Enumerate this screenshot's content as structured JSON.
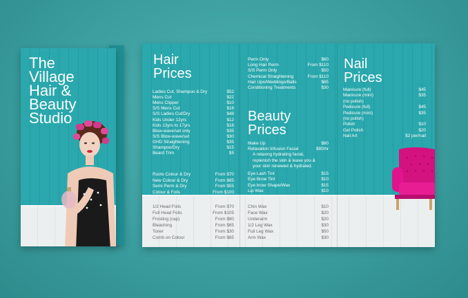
{
  "front": {
    "title_lines": [
      "The",
      "Village",
      "Hair &",
      "Beauty",
      "Studio"
    ]
  },
  "hair": {
    "title_line1": "Hair",
    "title_line2": "Prices",
    "items": [
      {
        "name": "Ladies Cut, Shampoo & Dry",
        "price": "$52"
      },
      {
        "name": "Mens Cut",
        "price": "$22"
      },
      {
        "name": "Mens Clipper",
        "price": "$10"
      },
      {
        "name": "S/S Mens Cut",
        "price": "$18"
      },
      {
        "name": "S/S Ladies Cut/Dry",
        "price": "$48"
      },
      {
        "name": "Kids Under 12yrs",
        "price": "$12"
      },
      {
        "name": "Kids 13yrs to 17yrs",
        "price": "$18"
      },
      {
        "name": "Blow-wave/set only",
        "price": "$35"
      },
      {
        "name": "S/S Blow-wave/set",
        "price": "$30"
      },
      {
        "name": "GHD Straightening",
        "price": "$35"
      },
      {
        "name": "Shampoo/Dry",
        "price": "$15"
      },
      {
        "name": "Beard Trim",
        "price": "$5"
      }
    ],
    "colour_items": [
      {
        "name": "Roots Colour & Dry",
        "price": "From $70"
      },
      {
        "name": "New Colour & Dry",
        "price": "From $65"
      },
      {
        "name": "Semi Perm & Dry",
        "price": "From $55"
      },
      {
        "name": "Colour & Foils",
        "price": "From $100"
      }
    ],
    "foil_items": [
      {
        "name": "1/2 Head Foils",
        "price": "From $70"
      },
      {
        "name": "Full Head Foils",
        "price": "From $105"
      },
      {
        "name": "Frosting (cap)",
        "price": "From $80"
      },
      {
        "name": "Bleaching",
        "price": "From $65"
      },
      {
        "name": "Toner",
        "price": "From $30"
      },
      {
        "name": "Comb on Colour",
        "price": "From $65"
      }
    ]
  },
  "middle": {
    "perm_items": [
      {
        "name": "Perm Only",
        "price": "$60"
      },
      {
        "name": "Long Hair Perm",
        "price": "From $110"
      },
      {
        "name": "S/S Perm Only",
        "price": "$50"
      },
      {
        "name": "Chemical Straightening",
        "price": "From $110"
      },
      {
        "name": "Hair Ups/Weddings/Balls",
        "price": "$65"
      },
      {
        "name": "Conditioning Treatments",
        "price": "$30"
      }
    ]
  },
  "beauty": {
    "title_line1": "Beauty",
    "title_line2": "Prices",
    "items": [
      {
        "name": "Make Up",
        "price": "$60"
      },
      {
        "name": "Relaxation Infusion Facial",
        "price": "$80/hr"
      }
    ],
    "facial_desc": [
      "A relaxing hydrating facial,",
      "replenish the skin & leave you &",
      "your skin renewed & hydrated."
    ],
    "tint_items": [
      {
        "name": "Eye Lash Tint",
        "price": "$15"
      },
      {
        "name": "Eye Brow Tint",
        "price": "$10"
      },
      {
        "name": "Eye brow Shape/Wax",
        "price": "$15"
      },
      {
        "name": "Lip Wax",
        "price": "$10"
      }
    ],
    "wax_items": [
      {
        "name": "Chin Wax",
        "price": "$10"
      },
      {
        "name": "Face Wax",
        "price": "$20"
      },
      {
        "name": "Underarm",
        "price": "$20"
      },
      {
        "name": "1/2 Leg Wax",
        "price": "$30"
      },
      {
        "name": "Full Leg Wax",
        "price": "$50"
      },
      {
        "name": "Arm Wax",
        "price": "$30"
      }
    ]
  },
  "nail": {
    "title_line1": "Nail",
    "title_line2": "Prices",
    "items": [
      {
        "name": "Manicure (full)",
        "price": "$45"
      },
      {
        "name": "Manicure (mini)",
        "price": "$35"
      },
      {
        "name": "(no polish)",
        "price": ""
      },
      {
        "name": "Pedicure (full)",
        "price": "$45"
      },
      {
        "name": "Pedicure (mini)",
        "price": "$35"
      },
      {
        "name": "(no polish)",
        "price": ""
      },
      {
        "name": "Polish",
        "price": "$10"
      },
      {
        "name": "Gel Polish",
        "price": "$20"
      },
      {
        "name": "Nail Art",
        "price": "$2 per/nail"
      }
    ]
  },
  "colors": {
    "teal_panel": "#2aa8ad",
    "background": "#3a9c9d",
    "chair_pink": "#e0148c",
    "curler_pink": "#d23a8a"
  }
}
